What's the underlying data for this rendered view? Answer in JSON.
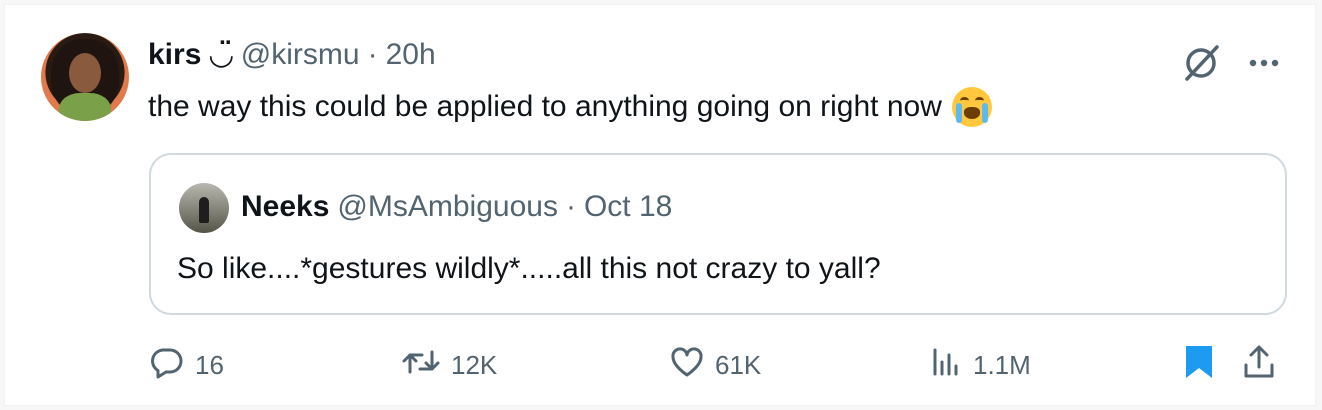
{
  "tweet": {
    "author_name": "kirs ◡̈",
    "author_handle": "@kirsmu",
    "separator": "·",
    "time": "20h",
    "text": "the way this could be applied to anything going on right now",
    "emoji": "loudly-crying-face"
  },
  "quote": {
    "author_name": "Neeks",
    "author_handle": "@MsAmbiguous",
    "separator": "·",
    "date": "Oct 18",
    "text": "So like....*gestures wildly*.....all this not crazy to yall?"
  },
  "actions": {
    "replies": "16",
    "reposts": "12K",
    "likes": "61K",
    "views": "1.1M"
  },
  "icons": {
    "top": [
      "grok-icon",
      "more-icon"
    ],
    "actions": [
      "reply-icon",
      "repost-icon",
      "like-icon",
      "views-icon",
      "bookmark-icon",
      "share-icon"
    ]
  },
  "colors": {
    "text": "#0f1419",
    "muted": "#536471",
    "accent": "#1d9bf0",
    "border": "#cfd9de"
  }
}
